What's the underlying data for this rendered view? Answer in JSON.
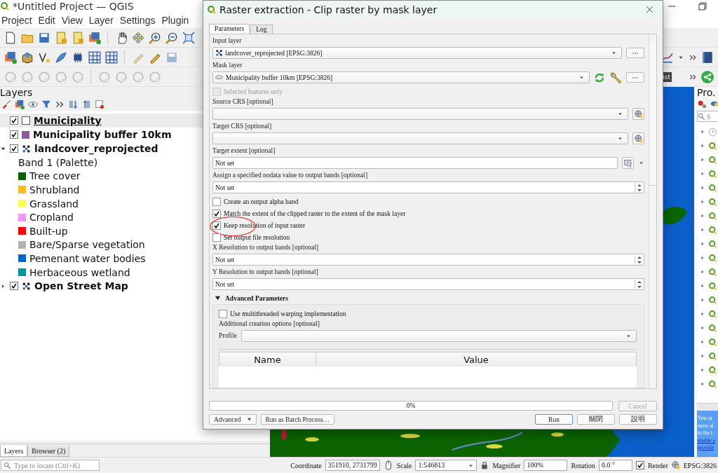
{
  "app": {
    "title": "*Untitled Project — QGIS",
    "menu": [
      "Project",
      "Edit",
      "View",
      "Layer",
      "Settings",
      "Plugin"
    ],
    "toolbar_fragment": "ist"
  },
  "layers_panel": {
    "title": "Layers",
    "layers": [
      {
        "kind": "outline",
        "name": "Municipality",
        "checked": true,
        "selected": true
      },
      {
        "kind": "fill",
        "name": "Municipality buffer 10km",
        "checked": true,
        "selected": false,
        "color": "#8e5ba0"
      },
      {
        "kind": "raster",
        "name": "landcover_reprojected",
        "checked": true,
        "selected": false,
        "expanded": true,
        "children": [
          {
            "kind": "label",
            "name": "Band 1 (Palette)"
          },
          {
            "kind": "legend",
            "name": "Tree cover",
            "color": "#006400"
          },
          {
            "kind": "legend",
            "name": "Shrubland",
            "color": "#ffbb22"
          },
          {
            "kind": "legend",
            "name": "Grassland",
            "color": "#ffff4c"
          },
          {
            "kind": "legend",
            "name": "Cropland",
            "color": "#f096ff"
          },
          {
            "kind": "legend",
            "name": "Built-up",
            "color": "#fa0000"
          },
          {
            "kind": "legend",
            "name": "Bare/Sparse vegetation",
            "color": "#b4b4b4"
          },
          {
            "kind": "legend",
            "name": "Pemenant water bodies",
            "color": "#0064c8"
          },
          {
            "kind": "legend",
            "name": "Herbaceous wetland",
            "color": "#0096a0"
          }
        ]
      },
      {
        "kind": "raster",
        "name": "Open Street Map",
        "checked": true,
        "selected": false,
        "expanded": false
      }
    ]
  },
  "bottom_tabs": [
    {
      "label": "Layers",
      "selected": true
    },
    {
      "label": "Browser (2)",
      "selected": false
    }
  ],
  "locator": {
    "placeholder": "Type to locate (Ctrl+K)"
  },
  "status_bar": {
    "coordinate_label": "Coordinate",
    "coordinate": "351910, 2731799",
    "scale_label": "Scale",
    "scale": "1:546813",
    "magnifier_label": "Magnifier",
    "magnifier": "100%",
    "rotation_label": "Rotation",
    "rotation": "0.0 °",
    "render_label": "Render",
    "render": true,
    "crs": "EPSG:3826"
  },
  "toolbox": {
    "title": "Pro.",
    "search_placeholder": "S",
    "info_lines": [
      {
        "text": "You ca",
        "link": false
      },
      {
        "text": "more al",
        "link": false
      },
      {
        "text": "to the t",
        "link": false
      },
      {
        "text": "enable a",
        "link": true
      },
      {
        "text": "provide",
        "link": true
      }
    ]
  },
  "dialog": {
    "title": "Raster extraction - Clip raster by mask layer",
    "tabs": [
      {
        "label": "Parameters",
        "selected": true
      },
      {
        "label": "Log",
        "selected": false
      }
    ],
    "parameters": [
      {
        "kind": "layer",
        "label": "Input layer",
        "value": "landcover_reprojected [EPSG:3826]"
      },
      {
        "kind": "mask",
        "label": "Mask layer",
        "value": "Municipality buffer 10km [EPSG:3826]"
      },
      {
        "kind": "checkbox",
        "label": "Selected features only",
        "checked": false,
        "disabled": true,
        "circled": false
      },
      {
        "kind": "crs",
        "label": "Source CRS [optional]"
      },
      {
        "kind": "crs",
        "label": "Target CRS [optional]"
      },
      {
        "kind": "extent",
        "label": "Target extent [optional]",
        "value": "Not set"
      },
      {
        "kind": "spin",
        "label": "Assign a specified nodata value to output bands [optional]",
        "value": "Not set"
      },
      {
        "kind": "checkbox",
        "label": "Create an output alpha band",
        "checked": false,
        "disabled": false,
        "circled": false
      },
      {
        "kind": "checkbox",
        "label": "Match the extent of the clipped raster to the extent of the mask layer",
        "checked": true,
        "disabled": false,
        "circled": false
      },
      {
        "kind": "checkbox",
        "label": "Keep resolution of input raster",
        "checked": true,
        "disabled": false,
        "circled": true
      },
      {
        "kind": "checkbox",
        "label": "Set output file resolution",
        "checked": false,
        "disabled": false,
        "circled": false
      },
      {
        "kind": "spin",
        "label": "X Resolution to output bands [optional]",
        "value": "Not set"
      },
      {
        "kind": "spin",
        "label": "Y Resolution to output bands [optional]",
        "value": "Not set"
      }
    ],
    "advanced": {
      "title": "Advanced Parameters",
      "expanded": true,
      "multithreaded": {
        "label": "Use multithreaded warping implementation",
        "checked": false
      },
      "creation_options_label": "Additional creation options [optional]",
      "profile_label": "Profile",
      "table": {
        "columns": [
          "Name",
          "Value"
        ]
      }
    },
    "progress": {
      "text": "0%",
      "level": 0
    },
    "buttons": {
      "advanced": "Advanced",
      "batch": "Run as Batch Process…",
      "run": "Run",
      "close": "關閉",
      "help": "說明",
      "cancel": "Cancel",
      "cancel_disabled": true
    }
  }
}
